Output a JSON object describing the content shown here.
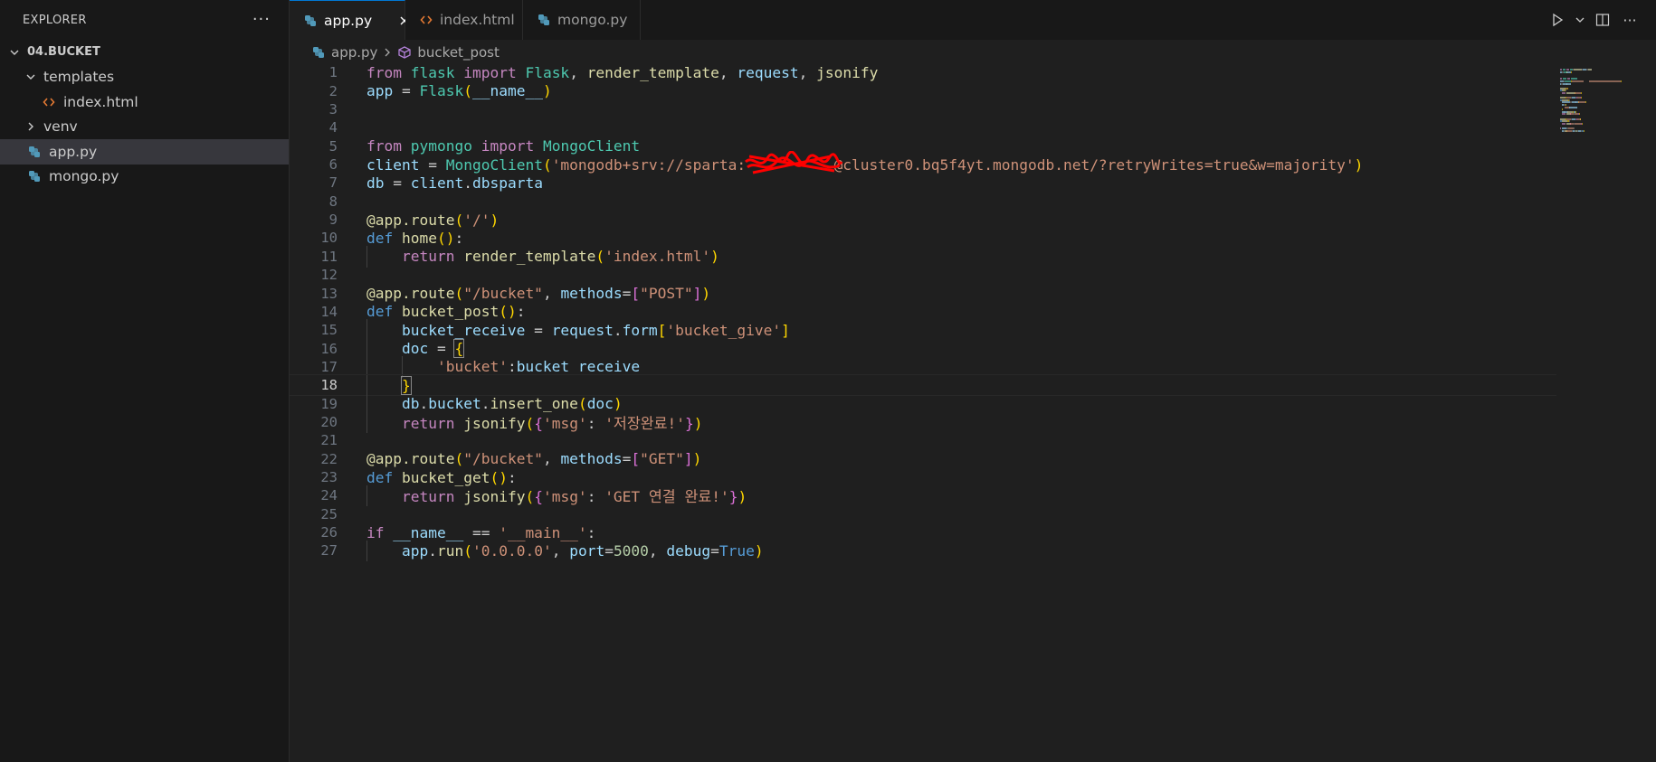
{
  "sidebar": {
    "title": "EXPLORER",
    "more": "···",
    "root": "04.BUCKET",
    "items": [
      {
        "label": "templates",
        "kind": "folder-open",
        "indent": 1
      },
      {
        "label": "index.html",
        "kind": "html",
        "indent": 2
      },
      {
        "label": "venv",
        "kind": "folder-closed",
        "indent": 1
      },
      {
        "label": "app.py",
        "kind": "python",
        "indent": 1,
        "selected": true
      },
      {
        "label": "mongo.py",
        "kind": "python",
        "indent": 1
      }
    ]
  },
  "tabs": [
    {
      "label": "app.py",
      "icon": "python-icon",
      "active": true
    },
    {
      "label": "index.html",
      "icon": "html-icon",
      "active": false
    },
    {
      "label": "mongo.py",
      "icon": "python-icon",
      "active": false
    }
  ],
  "breadcrumb": {
    "file": "app.py",
    "symbol": "bucket_post"
  },
  "editor": {
    "current_line": 18,
    "lines": [
      [
        [
          "kw",
          "from"
        ],
        [
          "plain",
          " "
        ],
        [
          "cls",
          "flask"
        ],
        [
          "plain",
          " "
        ],
        [
          "kw",
          "import"
        ],
        [
          "plain",
          " "
        ],
        [
          "cls",
          "Flask"
        ],
        [
          "plain",
          ", "
        ],
        [
          "fn",
          "render_template"
        ],
        [
          "plain",
          ", "
        ],
        [
          "var",
          "request"
        ],
        [
          "plain",
          ", "
        ],
        [
          "fn",
          "jsonify"
        ]
      ],
      [
        [
          "var",
          "app"
        ],
        [
          "plain",
          " = "
        ],
        [
          "cls",
          "Flask"
        ],
        [
          "br1",
          "("
        ],
        [
          "var",
          "__name__"
        ],
        [
          "br1",
          ")"
        ]
      ],
      [],
      [],
      [
        [
          "kw",
          "from"
        ],
        [
          "plain",
          " "
        ],
        [
          "cls",
          "pymongo"
        ],
        [
          "plain",
          " "
        ],
        [
          "kw",
          "import"
        ],
        [
          "plain",
          " "
        ],
        [
          "cls",
          "MongoClient"
        ]
      ],
      [
        [
          "var",
          "client"
        ],
        [
          "plain",
          " = "
        ],
        [
          "cls",
          "MongoClient"
        ],
        [
          "br1",
          "("
        ],
        [
          "str",
          "'mongodb+srv://sparta:"
        ],
        [
          "redact",
          "          "
        ],
        [
          "str",
          "@cluster0.bq5f4yt.mongodb.net/?retryWrites=true&w=majority'"
        ],
        [
          "br1",
          ")"
        ]
      ],
      [
        [
          "var",
          "db"
        ],
        [
          "plain",
          " = "
        ],
        [
          "var",
          "client"
        ],
        [
          "plain",
          "."
        ],
        [
          "var",
          "dbsparta"
        ]
      ],
      [],
      [
        [
          "fn",
          "@app.route"
        ],
        [
          "br1",
          "("
        ],
        [
          "str",
          "'/'"
        ],
        [
          "br1",
          ")"
        ]
      ],
      [
        [
          "kw2",
          "def"
        ],
        [
          "plain",
          " "
        ],
        [
          "fn",
          "home"
        ],
        [
          "br1",
          "()"
        ],
        [
          "plain",
          ":"
        ]
      ],
      [
        [
          "plain",
          "    "
        ],
        [
          "kw",
          "return"
        ],
        [
          "plain",
          " "
        ],
        [
          "fn",
          "render_template"
        ],
        [
          "br1",
          "("
        ],
        [
          "str",
          "'index.html'"
        ],
        [
          "br1",
          ")"
        ]
      ],
      [],
      [
        [
          "fn",
          "@app.route"
        ],
        [
          "br1",
          "("
        ],
        [
          "str",
          "\"/bucket\""
        ],
        [
          "plain",
          ", "
        ],
        [
          "var",
          "methods"
        ],
        [
          "plain",
          "="
        ],
        [
          "br2",
          "["
        ],
        [
          "str",
          "\"POST\""
        ],
        [
          "br2",
          "]"
        ],
        [
          "br1",
          ")"
        ]
      ],
      [
        [
          "kw2",
          "def"
        ],
        [
          "plain",
          " "
        ],
        [
          "fn",
          "bucket_post"
        ],
        [
          "br1",
          "()"
        ],
        [
          "plain",
          ":"
        ]
      ],
      [
        [
          "plain",
          "    "
        ],
        [
          "var",
          "bucket_receive"
        ],
        [
          "plain",
          " = "
        ],
        [
          "var",
          "request"
        ],
        [
          "plain",
          "."
        ],
        [
          "var",
          "form"
        ],
        [
          "br1",
          "["
        ],
        [
          "str",
          "'bucket_give'"
        ],
        [
          "br1",
          "]"
        ]
      ],
      [
        [
          "plain",
          "    "
        ],
        [
          "var",
          "doc"
        ],
        [
          "plain",
          " = "
        ],
        [
          "br1box",
          "{"
        ]
      ],
      [
        [
          "plain",
          "        "
        ],
        [
          "str",
          "'bucket'"
        ],
        [
          "plain",
          ":"
        ],
        [
          "var",
          "bucket_receive"
        ]
      ],
      [
        [
          "plain",
          "    "
        ],
        [
          "br1box",
          "}"
        ]
      ],
      [
        [
          "plain",
          "    "
        ],
        [
          "var",
          "db"
        ],
        [
          "plain",
          "."
        ],
        [
          "var",
          "bucket"
        ],
        [
          "plain",
          "."
        ],
        [
          "fn",
          "insert_one"
        ],
        [
          "br1",
          "("
        ],
        [
          "var",
          "doc"
        ],
        [
          "br1",
          ")"
        ]
      ],
      [
        [
          "plain",
          "    "
        ],
        [
          "kw",
          "return"
        ],
        [
          "plain",
          " "
        ],
        [
          "fn",
          "jsonify"
        ],
        [
          "br1",
          "("
        ],
        [
          "br2",
          "{"
        ],
        [
          "str",
          "'msg'"
        ],
        [
          "plain",
          ": "
        ],
        [
          "str",
          "'저장완료!'"
        ],
        [
          "br2",
          "}"
        ],
        [
          "br1",
          ")"
        ]
      ],
      [],
      [
        [
          "fn",
          "@app.route"
        ],
        [
          "br1",
          "("
        ],
        [
          "str",
          "\"/bucket\""
        ],
        [
          "plain",
          ", "
        ],
        [
          "var",
          "methods"
        ],
        [
          "plain",
          "="
        ],
        [
          "br2",
          "["
        ],
        [
          "str",
          "\"GET\""
        ],
        [
          "br2",
          "]"
        ],
        [
          "br1",
          ")"
        ]
      ],
      [
        [
          "kw2",
          "def"
        ],
        [
          "plain",
          " "
        ],
        [
          "fn",
          "bucket_get"
        ],
        [
          "br1",
          "()"
        ],
        [
          "plain",
          ":"
        ]
      ],
      [
        [
          "plain",
          "    "
        ],
        [
          "kw",
          "return"
        ],
        [
          "plain",
          " "
        ],
        [
          "fn",
          "jsonify"
        ],
        [
          "br1",
          "("
        ],
        [
          "br2",
          "{"
        ],
        [
          "str",
          "'msg'"
        ],
        [
          "plain",
          ": "
        ],
        [
          "str",
          "'GET 연결 완료!'"
        ],
        [
          "br2",
          "}"
        ],
        [
          "br1",
          ")"
        ]
      ],
      [],
      [
        [
          "kw",
          "if"
        ],
        [
          "plain",
          " "
        ],
        [
          "var",
          "__name__"
        ],
        [
          "plain",
          " == "
        ],
        [
          "str",
          "'__main__'"
        ],
        [
          "plain",
          ":"
        ]
      ],
      [
        [
          "plain",
          "    "
        ],
        [
          "var",
          "app"
        ],
        [
          "plain",
          "."
        ],
        [
          "fn",
          "run"
        ],
        [
          "br1",
          "("
        ],
        [
          "str",
          "'0.0.0.0'"
        ],
        [
          "plain",
          ", "
        ],
        [
          "var",
          "port"
        ],
        [
          "plain",
          "="
        ],
        [
          "num",
          "5000"
        ],
        [
          "plain",
          ", "
        ],
        [
          "var",
          "debug"
        ],
        [
          "plain",
          "="
        ],
        [
          "kw2",
          "True"
        ],
        [
          "br1",
          ")"
        ]
      ]
    ]
  },
  "colors": {
    "accent": "#0078d4",
    "python_icon": "#519aba",
    "html_icon": "#e37933",
    "symbol_icon": "#b180d7",
    "redaction": "#ff0000"
  }
}
